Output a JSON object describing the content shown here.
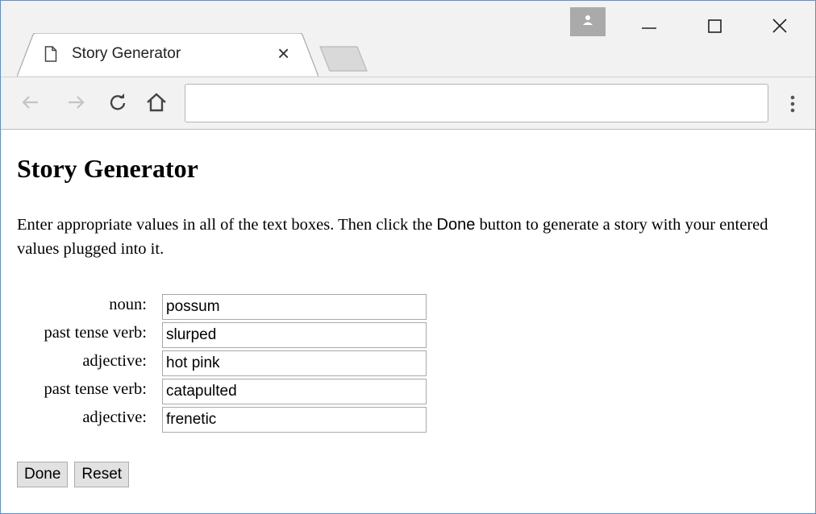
{
  "browser": {
    "tab_title": "Story Generator",
    "tab_close_glyph": "×",
    "url": "",
    "icons": [
      "page-icon",
      "profile-icon",
      "minimize-icon",
      "maximize-icon",
      "close-icon",
      "back-arrow-icon",
      "forward-arrow-icon",
      "reload-icon",
      "home-icon",
      "menu-dots-icon"
    ]
  },
  "page": {
    "heading": "Story Generator",
    "instructions_before": "Enter appropriate values in all of the text boxes. Then click the ",
    "instructions_button": "Done",
    "instructions_after": " button to generate a story with your entered values plugged into it."
  },
  "form": {
    "fields": [
      {
        "label": "noun:",
        "value": "possum"
      },
      {
        "label": "past tense verb:",
        "value": "slurped"
      },
      {
        "label": "adjective:",
        "value": "hot pink"
      },
      {
        "label": "past tense verb:",
        "value": "catapulted"
      },
      {
        "label": "adjective:",
        "value": "frenetic"
      }
    ],
    "done_label": "Done",
    "reset_label": "Reset"
  }
}
